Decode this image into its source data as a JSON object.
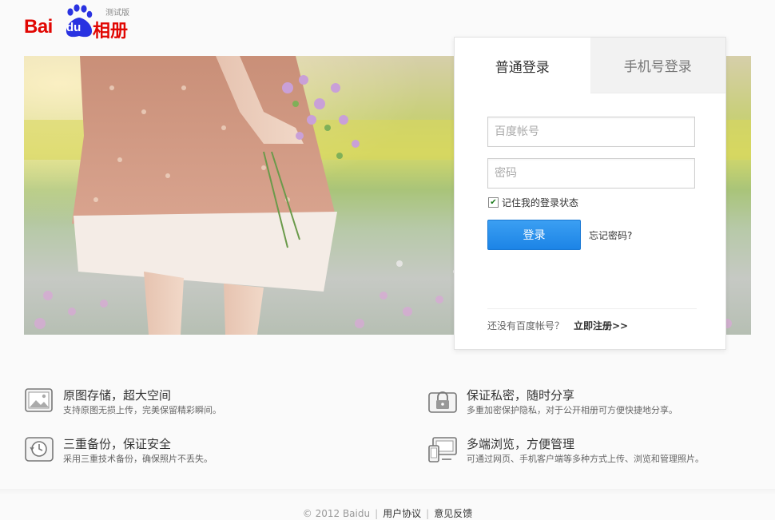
{
  "logo": {
    "bai": "Bai",
    "du": "du",
    "album": "相册",
    "beta": "测试版"
  },
  "login": {
    "tabs": [
      "普通登录",
      "手机号登录"
    ],
    "account_placeholder": "百度帐号",
    "password_placeholder": "密码",
    "remember_label": "记住我的登录状态",
    "remember_checked": true,
    "submit_label": "登录",
    "forgot_label": "忘记密码?",
    "no_account_text": "还没有百度帐号？",
    "register_label": "立即注册>>"
  },
  "features": [
    {
      "icon": "image-icon",
      "title": "原图存储，超大空间",
      "desc": "支持原图无损上传，完美保留精彩瞬间。"
    },
    {
      "icon": "lock-icon",
      "title": "保证私密，随时分享",
      "desc": "多重加密保护隐私，对于公开相册可方便快捷地分享。"
    },
    {
      "icon": "backup-clock-icon",
      "title": "三重备份，保证安全",
      "desc": "采用三重技术备份，确保照片不丢失。"
    },
    {
      "icon": "devices-icon",
      "title": "多端浏览，方便管理",
      "desc": "可通过网页、手机客户端等多种方式上传、浏览和管理照片。"
    }
  ],
  "footer": {
    "copyright": "© 2012 Baidu",
    "terms": "用户协议",
    "feedback": "意见反馈"
  },
  "colors": {
    "brand_red": "#e10602",
    "brand_blue": "#2932e1",
    "button_blue": "#1c84e6"
  }
}
